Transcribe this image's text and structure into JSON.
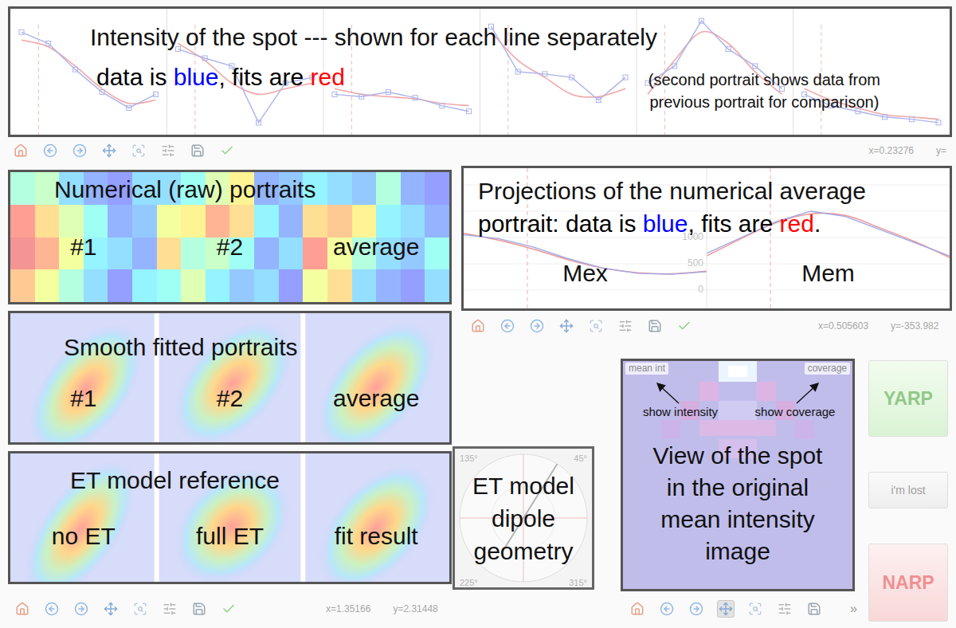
{
  "intensity_panel": {
    "title": "Intensity of the spot --- shown for each line separately",
    "legend": [
      {
        "text": "data is ",
        "color": "#000000"
      },
      {
        "text": "blue",
        "color": "#0000ff"
      },
      {
        "text": ", fits are ",
        "color": "#000000"
      },
      {
        "text": "red",
        "color": "#ff0000"
      }
    ],
    "note": [
      "(second portrait shows data from",
      "previous portrait for comparison)"
    ],
    "chart": {
      "lines": [
        {
          "data": [
            0.85,
            0.75,
            0.52,
            0.32,
            0.18,
            0.3
          ],
          "fit": [
            0.78,
            0.72,
            0.55,
            0.35,
            0.22,
            0.25
          ]
        },
        {
          "data": [
            0.7,
            0.62,
            0.55,
            0.05,
            0.4,
            0.45
          ],
          "fit": [
            0.75,
            0.6,
            0.4,
            0.3,
            0.35,
            0.4
          ]
        },
        {
          "data": [
            0.3,
            0.28,
            0.32,
            0.27,
            0.2,
            0.15
          ],
          "fit": [
            0.35,
            0.3,
            0.28,
            0.26,
            0.22,
            0.2
          ]
        },
        {
          "data": [
            0.9,
            0.5,
            0.48,
            0.45,
            0.25,
            0.45
          ],
          "fit": [
            0.85,
            0.6,
            0.45,
            0.3,
            0.28,
            0.35
          ]
        },
        {
          "data": [
            0.4,
            0.55,
            0.95,
            0.7,
            0.55,
            0.35
          ],
          "fit": [
            0.3,
            0.6,
            0.85,
            0.75,
            0.5,
            0.3
          ]
        },
        {
          "data": [
            0.3,
            0.2,
            0.15,
            0.1,
            0.08,
            0.05
          ],
          "fit": [
            0.35,
            0.25,
            0.18,
            0.12,
            0.1,
            0.08
          ]
        }
      ]
    }
  },
  "toolbars": {
    "intensity": {
      "x": "x=0.23276",
      "y": "y=",
      "pan_active": false
    },
    "projections": {
      "x": "x=0.505603",
      "y": "y=-353.982",
      "pan_active": false
    },
    "portraits": {
      "x": "x=1.35166",
      "y": "y=2.31448",
      "pan_active": false
    },
    "spot": {
      "pan_active": true,
      "overflow": "»"
    }
  },
  "raw_portraits": {
    "title": "Numerical (raw) portraits",
    "items": [
      {
        "label": "#1",
        "cells": [
          [
            0.45,
            0.5,
            0.3,
            0.2,
            0.15,
            0.3
          ],
          [
            0.85,
            0.7,
            0.55,
            0.4,
            0.2,
            0.25
          ],
          [
            0.9,
            0.8,
            0.6,
            0.35,
            0.3,
            0.2
          ],
          [
            0.75,
            0.6,
            0.45,
            0.3,
            0.15,
            0.35
          ]
        ]
      },
      {
        "label": "#2",
        "cells": [
          [
            0.3,
            0.4,
            0.55,
            0.65,
            0.2,
            0.25
          ],
          [
            0.6,
            0.65,
            0.8,
            0.7,
            0.35,
            0.2
          ],
          [
            0.7,
            0.45,
            0.5,
            0.4,
            0.2,
            0.3
          ],
          [
            0.4,
            0.55,
            0.35,
            0.25,
            0.3,
            0.15
          ]
        ]
      },
      {
        "label": "average",
        "cells": [
          [
            0.35,
            0.3,
            0.25,
            0.45,
            0.2,
            0.15
          ],
          [
            0.7,
            0.75,
            0.65,
            0.35,
            0.3,
            0.2
          ],
          [
            0.85,
            0.6,
            0.45,
            0.3,
            0.25,
            0.4
          ],
          [
            0.6,
            0.7,
            0.3,
            0.2,
            0.15,
            0.3
          ]
        ]
      }
    ]
  },
  "smooth_portraits": {
    "title": "Smooth fitted portraits",
    "items": [
      {
        "label": "#1"
      },
      {
        "label": "#2"
      },
      {
        "label": "average"
      }
    ]
  },
  "et_reference": {
    "title": "ET model reference",
    "items": [
      {
        "label": "no ET"
      },
      {
        "label": "full ET"
      },
      {
        "label": "fit result"
      }
    ]
  },
  "projections": {
    "title": "Projections of the numerical average",
    "legend": [
      {
        "text": "portrait: data is ",
        "color": "#000000"
      },
      {
        "text": "blue",
        "color": "#0000ff"
      },
      {
        "text": ", fits are ",
        "color": "#000000"
      },
      {
        "text": "red",
        "color": "#ff0000"
      },
      {
        "text": ".",
        "color": "#000000"
      }
    ],
    "ticks": [
      "1000",
      "500",
      "0"
    ],
    "plots": [
      {
        "label": "Mex",
        "data": [
          1050,
          980,
          820,
          600,
          420,
          320,
          300,
          350
        ],
        "fit": [
          1080,
          950,
          780,
          580,
          420,
          330,
          310,
          360
        ]
      },
      {
        "label": "Mem",
        "data": [
          700,
          1000,
          1300,
          1500,
          1400,
          1150,
          900,
          650
        ],
        "fit": [
          650,
          980,
          1280,
          1450,
          1420,
          1180,
          920,
          620
        ]
      }
    ]
  },
  "dipole": {
    "title": "ET model dipole geometry",
    "angle_labels": [
      "135°",
      "45°",
      "225°",
      "315°"
    ],
    "dipole_angle": 58
  },
  "spot_view": {
    "buttons": [
      "mean int",
      "coverage"
    ],
    "hints": [
      "show intensity",
      "show coverage"
    ],
    "text_lines": [
      "View of the spot",
      "in the original",
      "mean intensity",
      "image"
    ]
  },
  "decision_buttons": [
    {
      "label": "YARP",
      "kind": "accept",
      "disabled": true
    },
    {
      "label": "i'm lost",
      "kind": "neutral",
      "disabled": true
    },
    {
      "label": "NARP",
      "kind": "reject",
      "disabled": true
    }
  ]
}
